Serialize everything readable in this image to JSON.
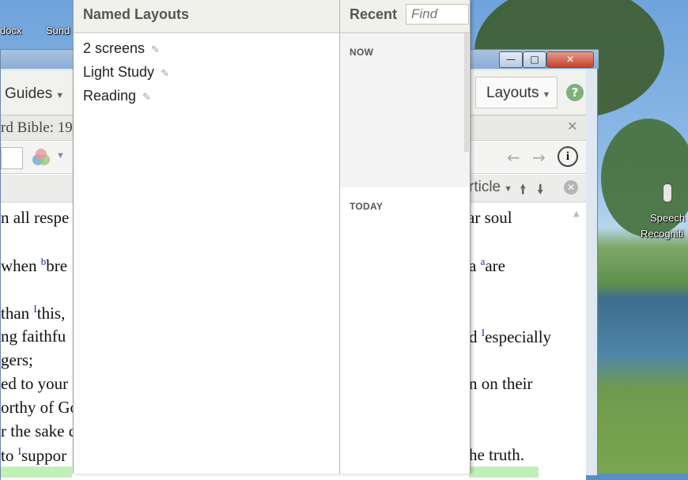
{
  "desktop": {
    "icons": [
      {
        "label": "docx"
      },
      {
        "label": "Sund"
      }
    ],
    "speech_icon": {
      "label_line1": "Speech",
      "label_line2": "Recogniti"
    }
  },
  "app": {
    "toolbar": {
      "guides_label": "Guides",
      "layouts_label": "Layouts",
      "help_icon": "question-icon"
    },
    "doc_title": "rd Bible: 19",
    "article_label": "rticle",
    "text_left": [
      "n all respe",
      "when ",
      "than ",
      "ng faithfu",
      "gers;",
      "ed to your",
      "orthy of Go",
      "r the sake c",
      "to "
    ],
    "inline_left": {
      "b": "b",
      "bre": "bre",
      "I1": "I",
      "this": "this,",
      "I2": "I",
      "suppor": "suppor"
    },
    "text_right": [
      "ar soul",
      "are",
      "especially",
      "n on their",
      "he truth."
    ],
    "inline_right": {
      "a": "a",
      "dot": "a",
      "I": "I",
      "d": "d"
    }
  },
  "panel": {
    "named": {
      "header": "Named Layouts",
      "items": [
        "2 screens",
        "Light Study",
        "Reading"
      ]
    },
    "recent": {
      "header": "Recent",
      "find_placeholder": "Find",
      "sections": [
        "NOW",
        "TODAY"
      ]
    }
  }
}
